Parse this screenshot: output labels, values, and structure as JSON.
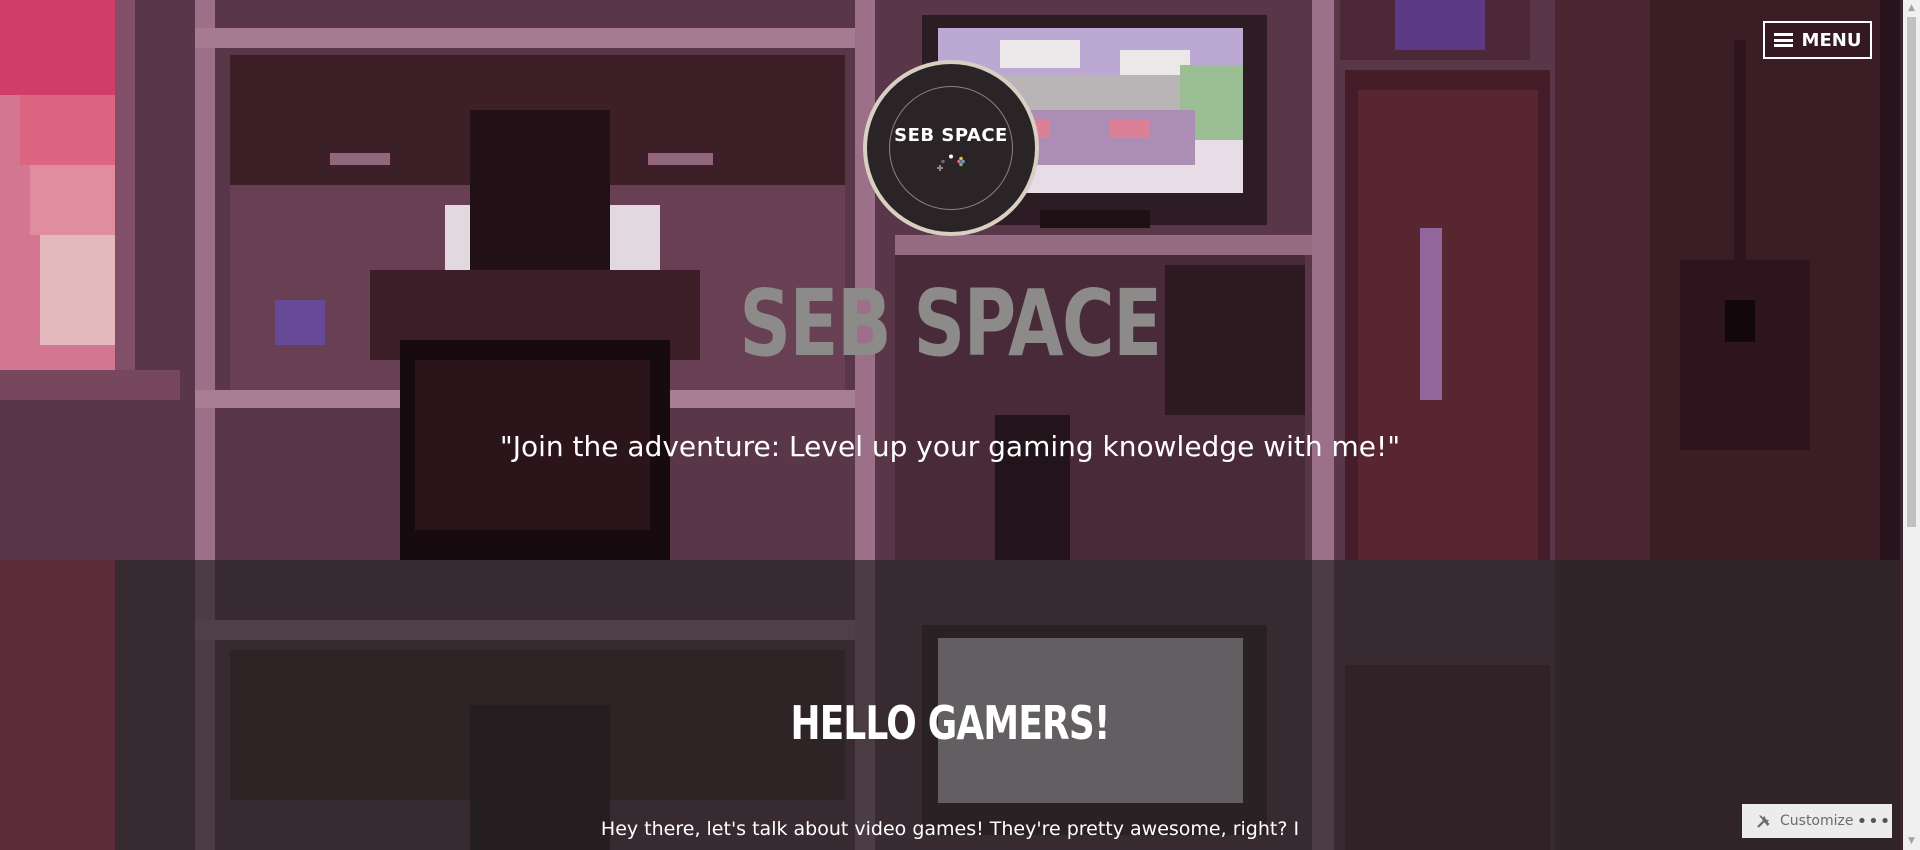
{
  "header": {
    "menu_label": "MENU",
    "menu_icon": "hamburger-icon"
  },
  "logo": {
    "text": "SEB SPACE",
    "icon": "gamepad-icon"
  },
  "site": {
    "title": "SEB SPACE",
    "tagline": "\"Join the adventure: Level up your gaming knowledge with me!\""
  },
  "content": {
    "heading": "HELLO GAMERS!",
    "intro": "Hey there, let's talk about video games! They're pretty awesome, right? I"
  },
  "customizer": {
    "label": "Customize",
    "icon": "tools-icon",
    "more_icon": "more-icon"
  },
  "colors": {
    "hero_tint": "#5a3346",
    "title": "#8d8a8a",
    "text": "#ffffff"
  }
}
